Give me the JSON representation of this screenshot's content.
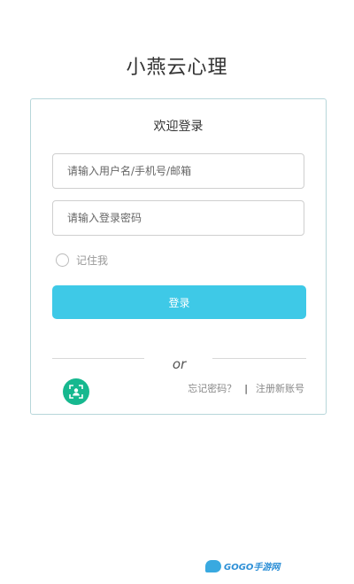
{
  "app": {
    "title": "小燕云心理"
  },
  "login": {
    "heading": "欢迎登录",
    "username_placeholder": "请输入用户名/手机号/邮箱",
    "password_placeholder": "请输入登录密码",
    "remember_label": "记住我",
    "submit_label": "登录",
    "divider_text": "or",
    "forgot_password": "忘记密码？",
    "separator": "|",
    "register": "注册新账号"
  },
  "icons": {
    "face_login": "face-scan-icon"
  },
  "watermark": {
    "text": "GOGO手游网"
  },
  "colors": {
    "accent": "#3ec9e7",
    "face_button": "#16b88f",
    "card_border": "#b7d6da"
  }
}
